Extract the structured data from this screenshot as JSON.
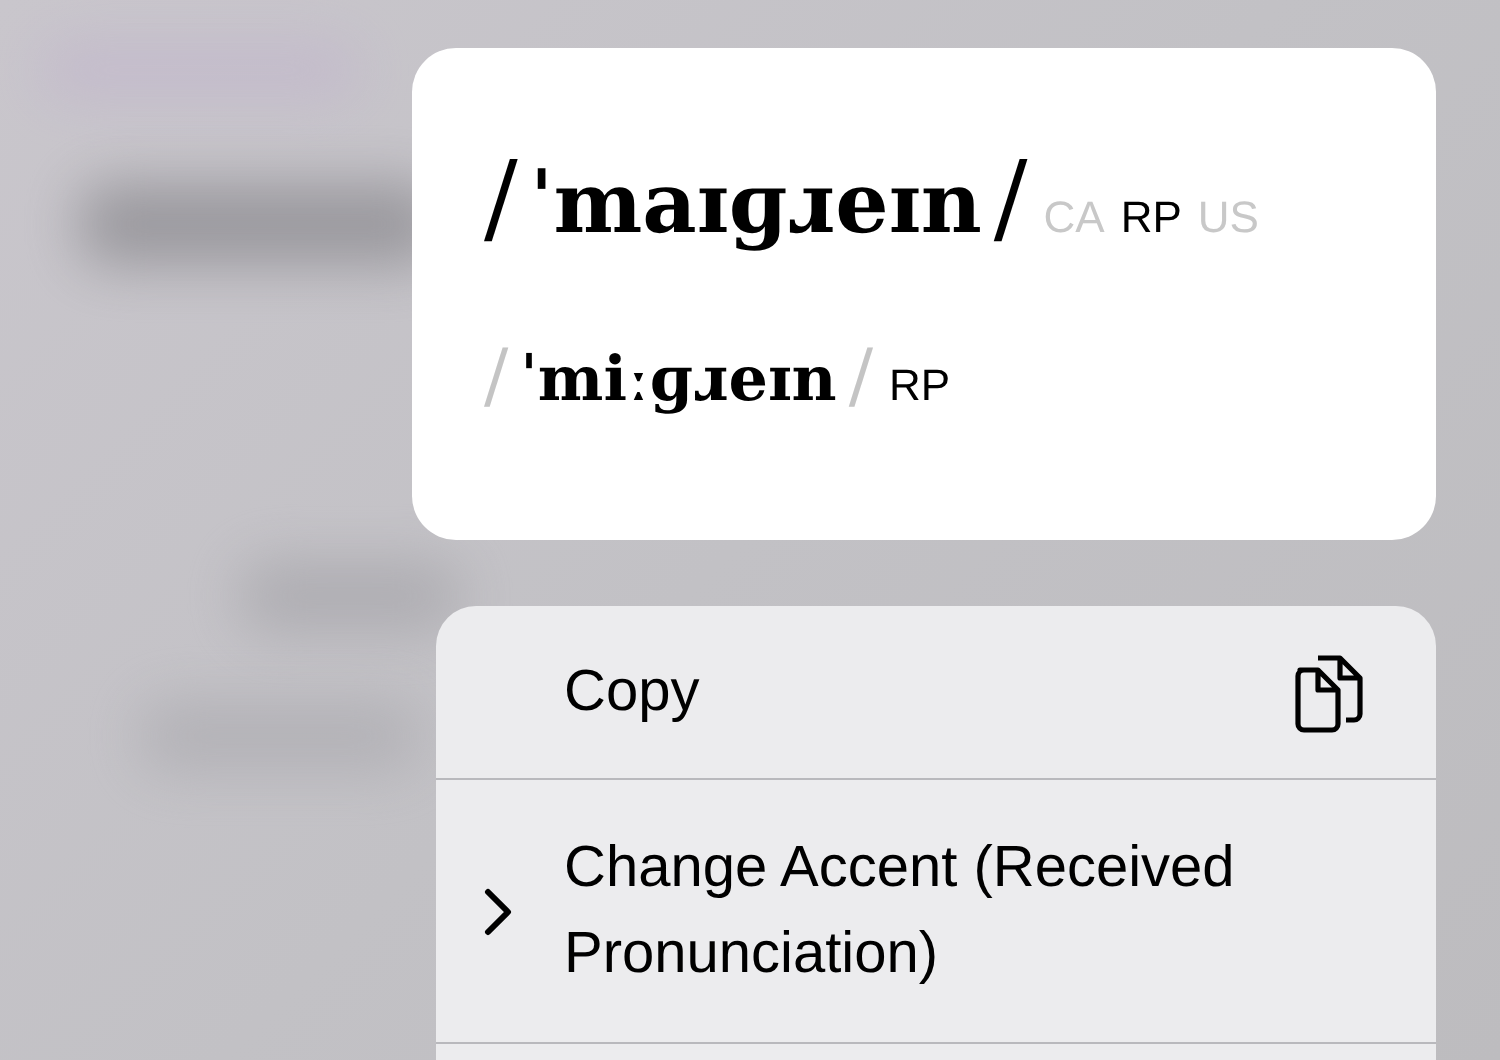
{
  "pronunciations": [
    {
      "delimiter": "/",
      "text": "ˈmaɪɡɹeɪn",
      "selected": true,
      "accents": [
        {
          "label": "CA",
          "selected": false
        },
        {
          "label": "RP",
          "selected": true
        },
        {
          "label": "US",
          "selected": false
        }
      ]
    },
    {
      "delimiter": "/",
      "text": "ˈmiːɡɹeɪn",
      "selected": false,
      "accents": [
        {
          "label": "RP",
          "selected": true
        }
      ]
    }
  ],
  "menu": [
    {
      "kind": "action",
      "label": "Copy"
    },
    {
      "kind": "submenu",
      "label": "Change Accent (Received Pronunciation)"
    }
  ]
}
